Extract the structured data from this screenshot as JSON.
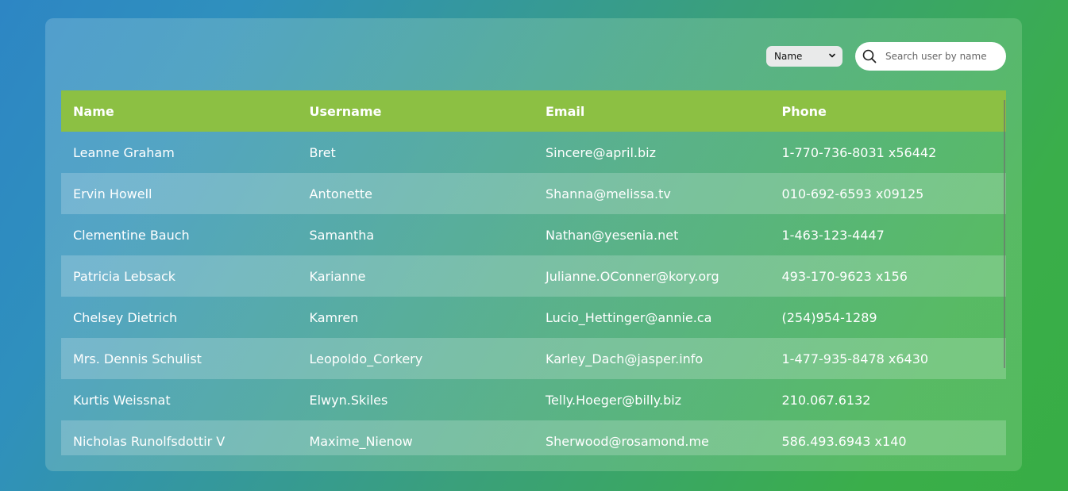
{
  "toolbar": {
    "filter_select": {
      "selected": "Name",
      "options": [
        "Name"
      ]
    },
    "search": {
      "placeholder": "Search user by name",
      "value": ""
    }
  },
  "table": {
    "columns": [
      "Name",
      "Username",
      "Email",
      "Phone"
    ],
    "rows": [
      [
        "Leanne Graham",
        "Bret",
        "Sincere@april.biz",
        "1-770-736-8031 x56442"
      ],
      [
        "Ervin Howell",
        "Antonette",
        "Shanna@melissa.tv",
        "010-692-6593 x09125"
      ],
      [
        "Clementine Bauch",
        "Samantha",
        "Nathan@yesenia.net",
        "1-463-123-4447"
      ],
      [
        "Patricia Lebsack",
        "Karianne",
        "Julianne.OConner@kory.org",
        "493-170-9623 x156"
      ],
      [
        "Chelsey Dietrich",
        "Kamren",
        "Lucio_Hettinger@annie.ca",
        "(254)954-1289"
      ],
      [
        "Mrs. Dennis Schulist",
        "Leopoldo_Corkery",
        "Karley_Dach@jasper.info",
        "1-477-935-8478 x6430"
      ],
      [
        "Kurtis Weissnat",
        "Elwyn.Skiles",
        "Telly.Hoeger@billy.biz",
        "210.067.6132"
      ],
      [
        "Nicholas Runolfsdottir V",
        "Maxime_Nienow",
        "Sherwood@rosamond.me",
        "586.493.6943 x140"
      ]
    ]
  }
}
